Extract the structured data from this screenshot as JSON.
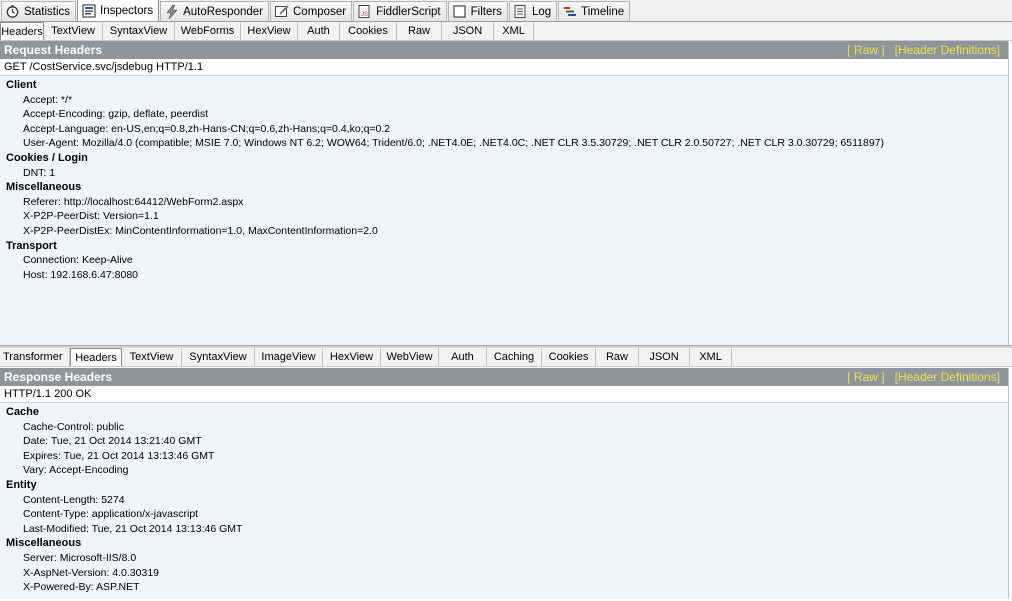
{
  "top_tabs": [
    {
      "label": "Statistics",
      "icon": "stopwatch-icon"
    },
    {
      "label": "Inspectors",
      "icon": "inspectors-icon"
    },
    {
      "label": "AutoResponder",
      "icon": "lightning-icon"
    },
    {
      "label": "Composer",
      "icon": "composer-icon"
    },
    {
      "label": "FiddlerScript",
      "icon": "script-icon"
    },
    {
      "label": "Filters",
      "icon": "checkbox-icon"
    },
    {
      "label": "Log",
      "icon": "log-icon"
    },
    {
      "label": "Timeline",
      "icon": "timeline-icon"
    }
  ],
  "request_tabs": [
    "Headers",
    "TextView",
    "SyntaxView",
    "WebForms",
    "HexView",
    "Auth",
    "Cookies",
    "Raw",
    "JSON",
    "XML"
  ],
  "request": {
    "title": "Request Headers",
    "raw_link": "[ Raw ]",
    "defs_link": "[Header Definitions]",
    "line": "GET /CostService.svc/jsdebug HTTP/1.1",
    "groups": [
      {
        "title": "Client",
        "items": [
          "Accept: */*",
          "Accept-Encoding: gzip, deflate, peerdist",
          "Accept-Language: en-US,en;q=0.8,zh-Hans-CN;q=0.6,zh-Hans;q=0.4,ko;q=0.2",
          "User-Agent: Mozilla/4.0 (compatible; MSIE 7.0; Windows NT 6.2; WOW64; Trident/6.0; .NET4.0E; .NET4.0C; .NET CLR 3.5.30729; .NET CLR 2.0.50727; .NET CLR 3.0.30729; 6511897)"
        ]
      },
      {
        "title": "Cookies / Login",
        "items": [
          "DNT: 1"
        ]
      },
      {
        "title": "Miscellaneous",
        "items": [
          "Referer: http://localhost:64412/WebForm2.aspx",
          "X-P2P-PeerDist: Version=1.1",
          "X-P2P-PeerDistEx: MinContentInformation=1.0, MaxContentInformation=2.0"
        ]
      },
      {
        "title": "Transport",
        "items": [
          "Connection: Keep-Alive",
          "Host: 192.168.6.47:8080"
        ]
      }
    ]
  },
  "response_tabs": [
    "Transformer",
    "Headers",
    "TextView",
    "SyntaxView",
    "ImageView",
    "HexView",
    "WebView",
    "Auth",
    "Caching",
    "Cookies",
    "Raw",
    "JSON",
    "XML"
  ],
  "response": {
    "title": "Response Headers",
    "raw_link": "[ Raw ]",
    "defs_link": "[Header Definitions]",
    "line": "HTTP/1.1 200 OK",
    "groups": [
      {
        "title": "Cache",
        "items": [
          "Cache-Control: public",
          "Date: Tue, 21 Oct 2014 13:21:40 GMT",
          "Expires: Tue, 21 Oct 2014 13:13:46 GMT",
          "Vary: Accept-Encoding"
        ]
      },
      {
        "title": "Entity",
        "items": [
          "Content-Length: 5274",
          "Content-Type: application/x-javascript",
          "Last-Modified: Tue, 21 Oct 2014 13:13:46 GMT"
        ]
      },
      {
        "title": "Miscellaneous",
        "items": [
          "Server: Microsoft-IIS/8.0",
          "X-AspNet-Version: 4.0.30319",
          "X-Powered-By: ASP.NET"
        ]
      }
    ]
  }
}
